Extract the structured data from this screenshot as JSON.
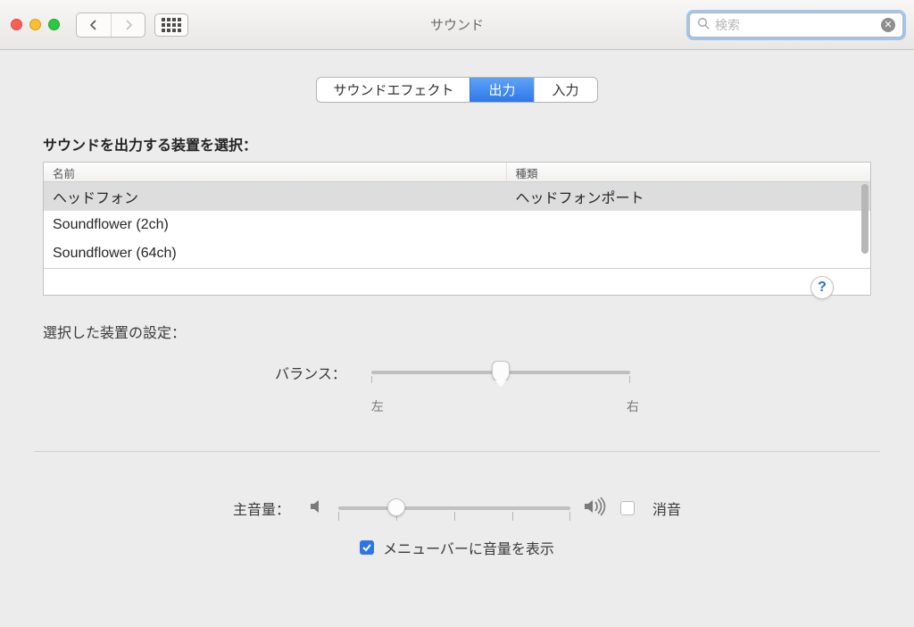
{
  "window": {
    "title": "サウンド",
    "search_placeholder": "検索"
  },
  "tabs": {
    "effects": "サウンドエフェクト",
    "output": "出力",
    "input": "入力",
    "active": "output"
  },
  "output": {
    "select_label": "サウンドを出力する装置を選択：",
    "columns": {
      "name": "名前",
      "type": "種類"
    },
    "devices": [
      {
        "name": "ヘッドフォン",
        "type": "ヘッドフォンポート",
        "selected": true
      },
      {
        "name": "Soundflower (2ch)",
        "type": "",
        "selected": false
      },
      {
        "name": "Soundflower (64ch)",
        "type": "",
        "selected": false
      }
    ],
    "settings_label": "選択した装置の設定：",
    "balance": {
      "label": "バランス：",
      "left": "左",
      "right": "右",
      "value": 0.5
    }
  },
  "footer": {
    "master_label": "主音量：",
    "master_value": 0.25,
    "mute_label": "消音",
    "mute_checked": false,
    "show_menu_label": "メニューバーに音量を表示",
    "show_menu_checked": true
  },
  "help": "?"
}
